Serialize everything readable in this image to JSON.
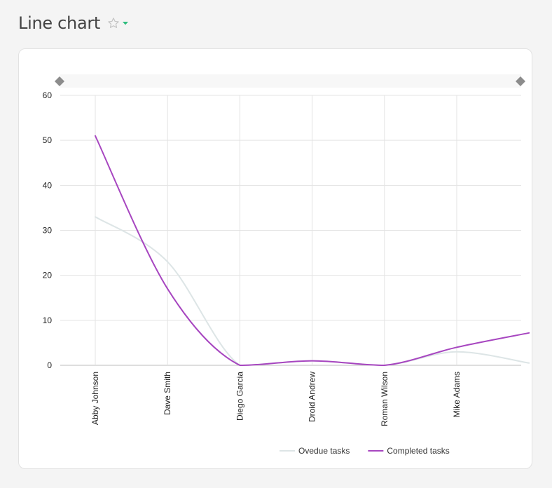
{
  "header": {
    "title": "Line chart",
    "favorite_icon": "star-outline-icon",
    "menu_icon": "caret-down-icon",
    "accent_color": "#2ebd7e"
  },
  "chart_data": {
    "type": "line",
    "title": "",
    "xlabel": "",
    "ylabel": "",
    "categories": [
      "Abby Johnson",
      "Dave Smith",
      "Diego Garcia",
      "Droid Andrew",
      "Roman Wilson",
      "Mike Adams",
      ""
    ],
    "ylim": [
      0,
      60
    ],
    "yticks": [
      0,
      10,
      20,
      30,
      40,
      50,
      60
    ],
    "grid": true,
    "legend": "bottom",
    "range_slider": true,
    "series": [
      {
        "name": "Ovedue tasks",
        "color": "#dde5e6",
        "values": [
          33,
          23,
          0,
          1,
          0,
          3,
          0.5
        ]
      },
      {
        "name": "Completed tasks",
        "color": "#a746c0",
        "values": [
          51,
          17,
          0,
          1,
          0,
          4,
          7.2
        ]
      }
    ]
  }
}
